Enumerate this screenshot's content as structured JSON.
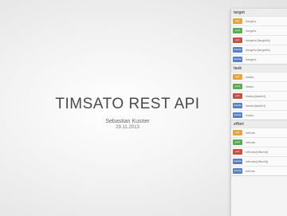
{
  "slide": {
    "title": "TIMSATO REST API",
    "author": "Sebastian Kusner",
    "date": "29.11.2013"
  },
  "colors": {
    "get": "#e8a33a",
    "post": "#5bab56",
    "put": "#c65043",
    "delete": "#5a7fc2"
  },
  "api": {
    "sections": [
      {
        "name": "target",
        "rows": [
          {
            "method": "get",
            "path": "/targets"
          },
          {
            "method": "post",
            "path": "/targets"
          },
          {
            "method": "put",
            "path": "/targets/{targetId}"
          },
          {
            "method": "delete",
            "path": "/targets/{targetId}"
          },
          {
            "method": "delete",
            "path": "/targets"
          }
        ]
      },
      {
        "name": "task",
        "rows": [
          {
            "method": "get",
            "path": "/tasks"
          },
          {
            "method": "post",
            "path": "/tasks"
          },
          {
            "method": "put",
            "path": "/tasks/{taskId}"
          },
          {
            "method": "delete",
            "path": "/tasks/{taskId}"
          },
          {
            "method": "delete",
            "path": "/tasks"
          }
        ]
      },
      {
        "name": "effort",
        "rows": [
          {
            "method": "get",
            "path": "/efforts"
          },
          {
            "method": "post",
            "path": "/efforts"
          },
          {
            "method": "put",
            "path": "/efforts/{effortId}"
          },
          {
            "method": "delete",
            "path": "/efforts/{effortId}"
          },
          {
            "method": "delete",
            "path": "/efforts"
          }
        ]
      }
    ]
  }
}
